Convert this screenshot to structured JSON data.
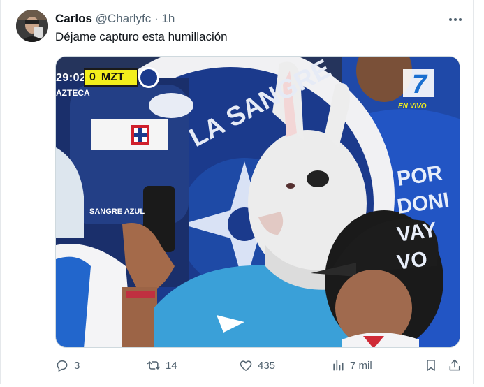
{
  "tweet": {
    "author_name": "Carlos",
    "handle": "@Charlyfc",
    "separator": "·",
    "time": "1h",
    "text": "Déjame capturo esta humillación"
  },
  "media": {
    "scoreboard": {
      "clock": "29:02",
      "score": "0",
      "team": "MZT",
      "broadcaster": "AZTECA"
    },
    "channel": {
      "number": "7",
      "live_label": "EN VIVO"
    },
    "banner_text": "LA SANGRE",
    "banner_emblem_text": "SANGRE AZUL",
    "shirt_text": [
      "POR",
      "DONI",
      "VAY",
      "VO"
    ]
  },
  "actions": {
    "replies": "3",
    "reposts": "14",
    "likes": "435",
    "views": "7 mil"
  },
  "colors": {
    "text_primary": "#0f1419",
    "text_secondary": "#536471",
    "score_yellow": "#f2ee1c"
  },
  "icons": [
    "more-icon",
    "reply-icon",
    "repost-icon",
    "like-icon",
    "views-icon",
    "bookmark-icon",
    "share-icon"
  ]
}
